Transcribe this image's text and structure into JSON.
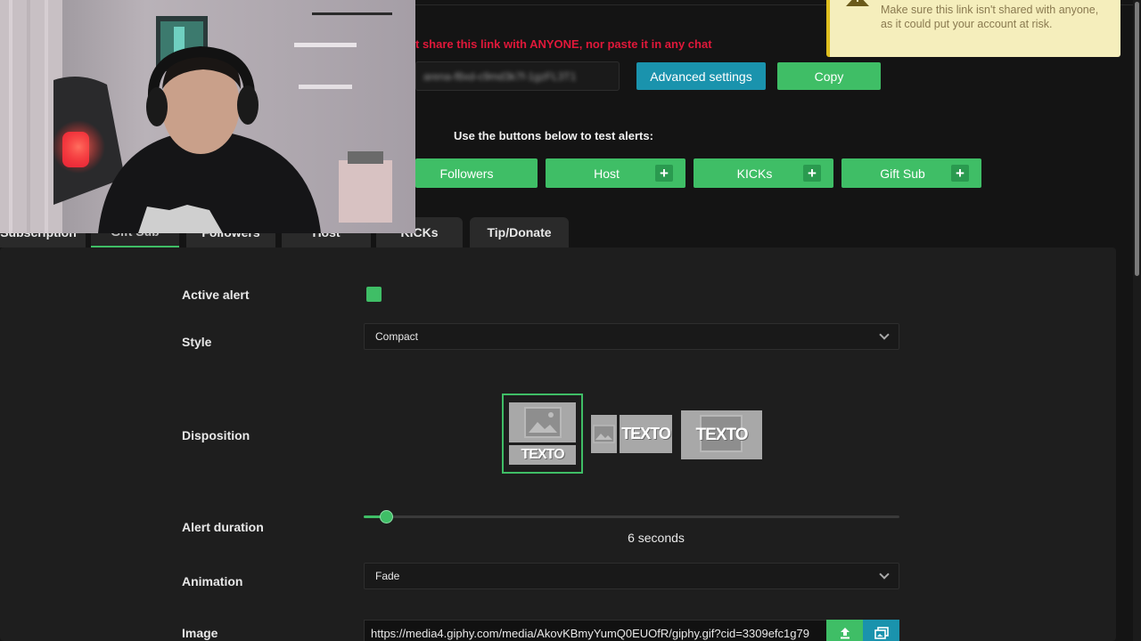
{
  "alert_box": {
    "warning_text": "t share this link with ANYONE, nor paste it in any chat",
    "link_value": "arena-f8xd-c9md3k7f-1gzFL3T1",
    "advanced_settings_label": "Advanced settings",
    "copy_label": "Copy"
  },
  "toast": {
    "message": "Make sure this link isn't shared with anyone, as it could put your account at risk."
  },
  "test_section": {
    "label": "Use the buttons below to test alerts:",
    "buttons": [
      "Followers",
      "Host",
      "KICKs",
      "Gift Sub"
    ],
    "plus_glyph": "+"
  },
  "tabs": [
    "Subscription",
    "Gift Sub",
    "Followers",
    "Host",
    "KICKs",
    "Tip/Donate"
  ],
  "form": {
    "active_alert_label": "Active alert",
    "active_alert_checked": true,
    "style_label": "Style",
    "style_value": "Compact",
    "disposition_label": "Disposition",
    "disposition_text": "TEXTO",
    "alert_duration_label": "Alert duration",
    "alert_duration_seconds": 6,
    "alert_duration_text": "6 seconds",
    "animation_label": "Animation",
    "animation_value": "Fade",
    "image_label": "Image",
    "image_url": "https://media4.giphy.com/media/AkovKBmyYumQ0EUOfR/giphy.gif?cid=3309efc1g79"
  },
  "colors": {
    "accent_green": "#3fbe66",
    "accent_blue": "#1a93ad",
    "warning_red": "#e0183a",
    "toast_bg": "#f5eebc"
  },
  "icons": {
    "upload": "upload-icon",
    "gallery": "gallery-icon",
    "warning": "warning-icon",
    "chevron": "chevron-down-icon"
  }
}
